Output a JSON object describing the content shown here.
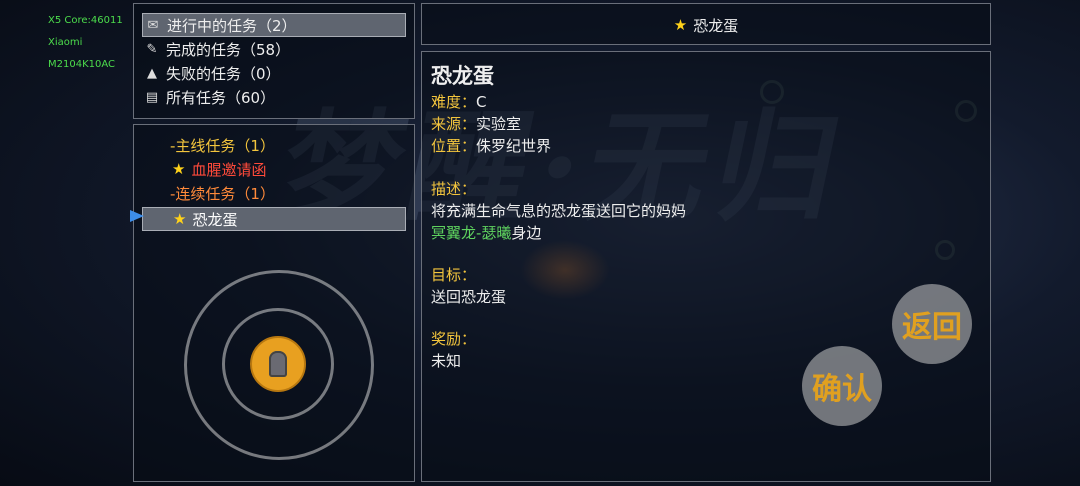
{
  "device": {
    "line1": "X5 Core:46011",
    "line2": "Xiaomi",
    "line3": "M2104K10AC"
  },
  "background_title": "梦醒·无归",
  "filters": [
    {
      "icon": "document-icon",
      "glyph": "✉",
      "label": "进行中的任务（2）",
      "selected": true
    },
    {
      "icon": "scroll-icon",
      "glyph": "✎",
      "label": "完成的任务（58）",
      "selected": false
    },
    {
      "icon": "tent-icon",
      "glyph": "▲",
      "label": "失败的任务（0）",
      "selected": false
    },
    {
      "icon": "book-icon",
      "glyph": "▤",
      "label": "所有任务（60）",
      "selected": false
    }
  ],
  "tree": {
    "main_group": "-主线任务（1）",
    "main_quest": "血腥邀请函",
    "chain_group": "-连续任务（1）",
    "chain_quest": "恐龙蛋"
  },
  "colors": {
    "group": "#f3c53d",
    "red_quest": "#ff4a3a",
    "orange_group": "#ff8a3a",
    "npc": "#5fd35f",
    "label": "#f3c53d"
  },
  "detail": {
    "header_title": "恐龙蛋",
    "name": "恐龙蛋",
    "difficulty_label": "难度：",
    "difficulty_value": "C",
    "source_label": "来源：",
    "source_value": "实验室",
    "location_label": "位置：",
    "location_value": "侏罗纪世界",
    "desc_label": "描述：",
    "desc_line1": "将充满生命气息的恐龙蛋送回它的妈妈",
    "desc_npc": "冥翼龙-瑟曦",
    "desc_npc_suffix": "身边",
    "goal_label": "目标：",
    "goal_value": "送回恐龙蛋",
    "reward_label": "奖励：",
    "reward_value": "未知"
  },
  "buttons": {
    "back": "返回",
    "confirm": "确认"
  }
}
